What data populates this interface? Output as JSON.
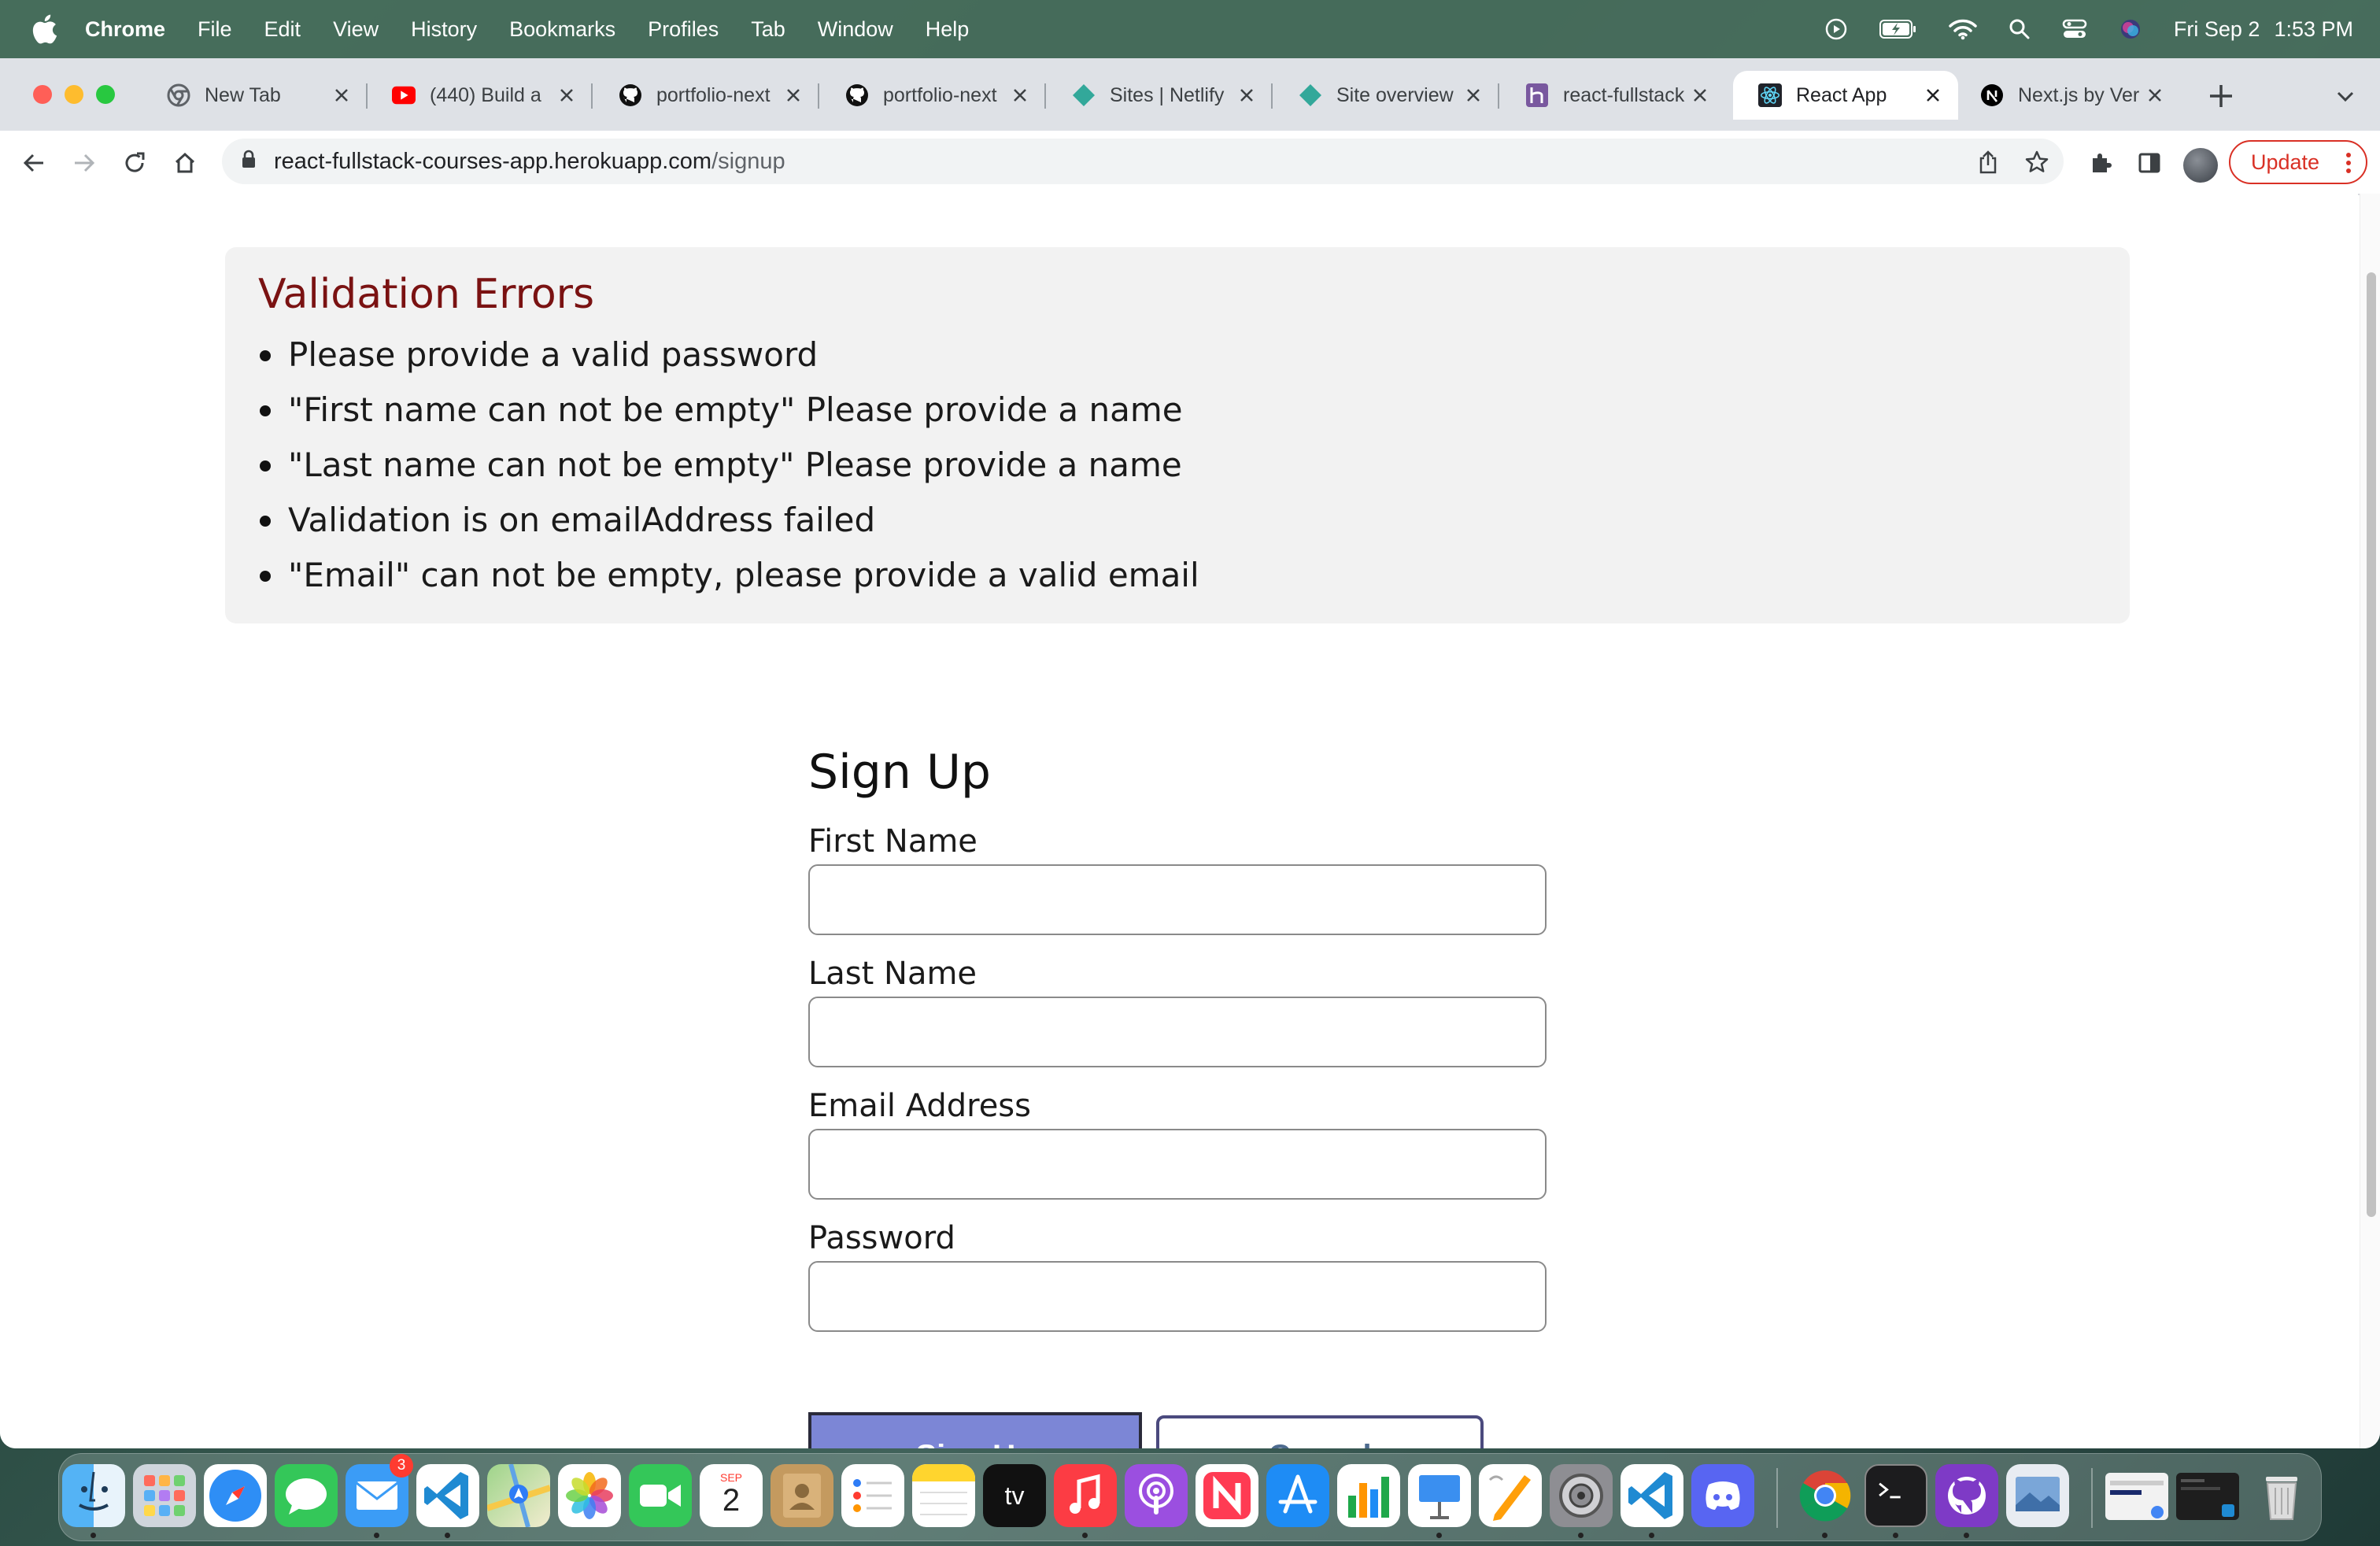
{
  "menubar": {
    "app_name": "Chrome",
    "items": [
      "File",
      "Edit",
      "View",
      "History",
      "Bookmarks",
      "Profiles",
      "Tab",
      "Window",
      "Help"
    ],
    "date": "Fri Sep 2",
    "time": "1:53 PM"
  },
  "tabs": [
    {
      "title": "New Tab",
      "icon": "chrome-icon"
    },
    {
      "title": "(440) Build a",
      "icon": "youtube-icon"
    },
    {
      "title": "portfolio-next",
      "icon": "github-icon"
    },
    {
      "title": "portfolio-next",
      "icon": "github-icon"
    },
    {
      "title": "Sites | Netlify",
      "icon": "netlify-icon"
    },
    {
      "title": "Site overview",
      "icon": "netlify-icon"
    },
    {
      "title": "react-fullstack",
      "icon": "heroku-icon"
    },
    {
      "title": "React App",
      "icon": "react-icon",
      "active": true
    },
    {
      "title": "Next.js by Ver",
      "icon": "nextjs-icon"
    }
  ],
  "address_bar": {
    "host": "react-fullstack-courses-app.herokuapp.com",
    "path": "/signup"
  },
  "toolbar": {
    "update_label": "Update"
  },
  "errors": {
    "title": "Validation Errors",
    "items": [
      "Please provide a valid password",
      "\"First name can not be empty\" Please provide a name",
      "\"Last name can not be empty\" Please provide a name",
      "Validation is on emailAddress failed",
      "\"Email\" can not be empty, please provide a valid email"
    ]
  },
  "form": {
    "title": "Sign Up",
    "fields": [
      {
        "label": "First Name",
        "value": ""
      },
      {
        "label": "Last Name",
        "value": ""
      },
      {
        "label": "Email Address",
        "value": ""
      },
      {
        "label": "Password",
        "value": ""
      }
    ],
    "submit_label": "Sign Up",
    "cancel_label": "Cancel"
  },
  "dock": {
    "apps": [
      "Finder",
      "Launchpad",
      "Safari",
      "Messages",
      "Mail",
      "Visual Studio Code",
      "Maps",
      "Photos",
      "FaceTime",
      "Calendar",
      "Contacts",
      "Reminders",
      "Notes",
      "TV",
      "Music",
      "Podcasts",
      "News",
      "App Store",
      "Numbers",
      "Keynote",
      "Pages",
      "System Preferences",
      "Visual Studio Code",
      "Discord",
      "Google Chrome",
      "Terminal",
      "GitHub Desktop",
      "Preview",
      "Recent Window",
      "Recent Window",
      "Trash"
    ],
    "mail_badge": "3",
    "calendar_month": "SEP",
    "calendar_day": "2",
    "tv_label": "tv"
  },
  "colors": {
    "error_title": "#7a1212",
    "signup_button": "#7c86d6",
    "cancel_border": "#4b4a7e",
    "update_red": "#d93025"
  }
}
